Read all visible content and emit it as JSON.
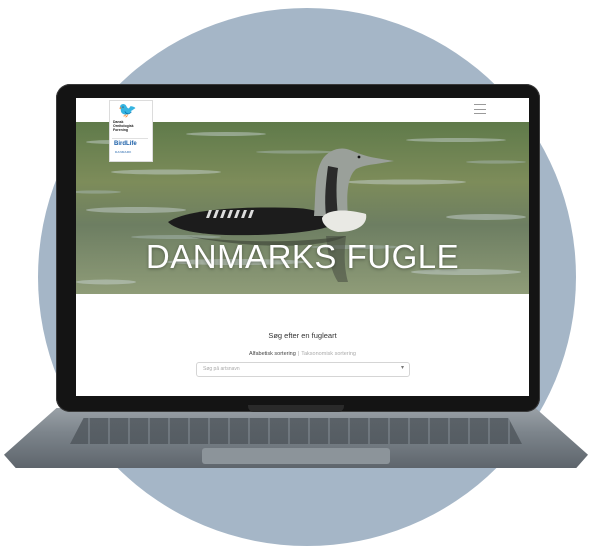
{
  "site": {
    "hero_title": "DANMARKS FUGLE",
    "logo": {
      "org_lines": [
        "Dansk",
        "Ornitologisk",
        "Forening"
      ],
      "birdlife_name": "BirdLife",
      "birdlife_sub": "DANMARK"
    },
    "photo_credit": ""
  },
  "search": {
    "title": "Søg efter en fugleart",
    "sort_active": "Alfabetisk sortering",
    "sort_separator": "|",
    "sort_inactive": "Taksonomisk sortering",
    "placeholder": "Søg på artsnavn"
  },
  "icons": {
    "menu": "hamburger-menu-icon",
    "dropdown": "chevron-down-icon"
  },
  "colors": {
    "background_circle": "#a5b6c7",
    "hero_text": "#ffffff",
    "birdlife_blue": "#1b5fa8"
  }
}
